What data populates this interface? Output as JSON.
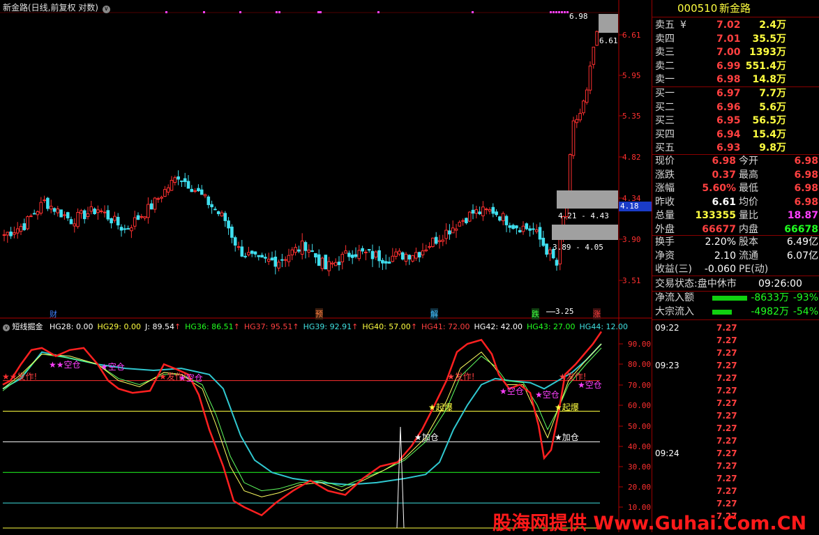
{
  "chart_header": {
    "title": "新金路(日线,前复权 对数)",
    "dropdown_icon": "chevron-down-icon"
  },
  "price_axis": {
    "ticks": [
      "6.61",
      "5.95",
      "5.35",
      "4.82",
      "4.34",
      "3.90",
      "3.51"
    ],
    "current_price_tag": "4.18",
    "last_price_label": "6.61",
    "high_label": "6.98",
    "low_label": "3.25",
    "zone1_label": "4.21 - 4.43",
    "zone2_label": "3.89 - 4.05"
  },
  "event_markers": [
    "财",
    "预",
    "解",
    "跌",
    "涨"
  ],
  "indicator": {
    "name": "短线掘金",
    "values": [
      {
        "label": "HG28: 0.00",
        "color": "#ffffff"
      },
      {
        "label": "HG29: 0.00",
        "color": "#ffff40"
      },
      {
        "label": "J: 89.54",
        "color": "#ffffff"
      },
      {
        "label": "HG36: 86.51",
        "color": "#20ff20"
      },
      {
        "label": "HG37: 95.51",
        "color": "#ff4040"
      },
      {
        "label": "HG39: 92.91",
        "color": "#40e0e0"
      },
      {
        "label": "HG40: 57.00",
        "color": "#ffff40"
      },
      {
        "label": "HG41: 72.00",
        "color": "#ff4040"
      },
      {
        "label": "HG42: 42.00",
        "color": "#ffffff"
      },
      {
        "label": "HG43: 27.00",
        "color": "#20ff20"
      },
      {
        "label": "HG44: 12.00",
        "color": "#40e0e0"
      }
    ],
    "axis_ticks": [
      "90.00",
      "80.00",
      "70.00",
      "60.00",
      "50.00",
      "40.00",
      "30.00",
      "20.00",
      "10.00"
    ],
    "signals": {
      "fazuo": "发作!",
      "kongcang": "空仓",
      "qibao": "起爆",
      "jiacang": "加仓"
    }
  },
  "quote": {
    "code": "000510",
    "name": "新金路",
    "yen_icon": "¥",
    "asks": [
      {
        "label": "卖五",
        "price": "7.02",
        "vol": "2.4万"
      },
      {
        "label": "卖四",
        "price": "7.01",
        "vol": "35.5万"
      },
      {
        "label": "卖三",
        "price": "7.00",
        "vol": "1393万"
      },
      {
        "label": "卖二",
        "price": "6.99",
        "vol": "551.4万"
      },
      {
        "label": "卖一",
        "price": "6.98",
        "vol": "14.8万"
      }
    ],
    "bids": [
      {
        "label": "买一",
        "price": "6.97",
        "vol": "7.7万"
      },
      {
        "label": "买二",
        "price": "6.96",
        "vol": "5.6万"
      },
      {
        "label": "买三",
        "price": "6.95",
        "vol": "56.5万"
      },
      {
        "label": "买四",
        "price": "6.94",
        "vol": "15.4万"
      },
      {
        "label": "买五",
        "price": "6.93",
        "vol": "9.8万"
      }
    ],
    "stats": [
      {
        "l1": "现价",
        "v1": "6.98",
        "l2": "今开",
        "v2": "6.98"
      },
      {
        "l1": "涨跌",
        "v1": "0.37",
        "l2": "最高",
        "v2": "6.98"
      },
      {
        "l1": "涨幅",
        "v1": "5.60%",
        "l2": "最低",
        "v2": "6.98"
      },
      {
        "l1": "昨收",
        "v1": "6.61",
        "l2": "均价",
        "v2": "6.98"
      },
      {
        "l1": "总量",
        "v1": "133355",
        "l2": "量比",
        "v2": "18.87"
      },
      {
        "l1": "外盘",
        "v1": "66677",
        "l2": "内盘",
        "v2": "66678"
      }
    ],
    "extra": [
      {
        "l1": "换手",
        "v1": "2.20%",
        "l2": "股本",
        "v2": "6.49亿"
      },
      {
        "l1": "净资",
        "v1": "2.10",
        "l2": "流通",
        "v2": "6.07亿"
      },
      {
        "l1": "收益(三)",
        "v1": "-0.060",
        "l2": "PE(动)",
        "v2": ""
      }
    ],
    "trade_status": "交易状态:盘中休市",
    "trade_time": "09:26:00",
    "flows": [
      {
        "label": "净流入额",
        "value": "-8633万",
        "pct": "-93%"
      },
      {
        "label": "大宗流入",
        "value": "-4982万",
        "pct": "-54%"
      }
    ],
    "ticks": [
      {
        "time": "09:22",
        "price": "7.27"
      },
      {
        "time": "",
        "price": "7.27"
      },
      {
        "time": "",
        "price": "7.27"
      },
      {
        "time": "09:23",
        "price": "7.27"
      },
      {
        "time": "",
        "price": "7.27"
      },
      {
        "time": "",
        "price": "7.27"
      },
      {
        "time": "",
        "price": "7.27"
      },
      {
        "time": "",
        "price": "7.27"
      },
      {
        "time": "",
        "price": "7.27"
      },
      {
        "time": "",
        "price": "7.27"
      },
      {
        "time": "09:24",
        "price": "7.27"
      },
      {
        "time": "",
        "price": "7.27"
      },
      {
        "time": "",
        "price": "7.27"
      },
      {
        "time": "",
        "price": "7.27"
      },
      {
        "time": "",
        "price": "7.27"
      },
      {
        "time": "",
        "price": "7.27"
      }
    ]
  },
  "watermark": "股海网提供 Www.Guhai.Com.CN"
}
